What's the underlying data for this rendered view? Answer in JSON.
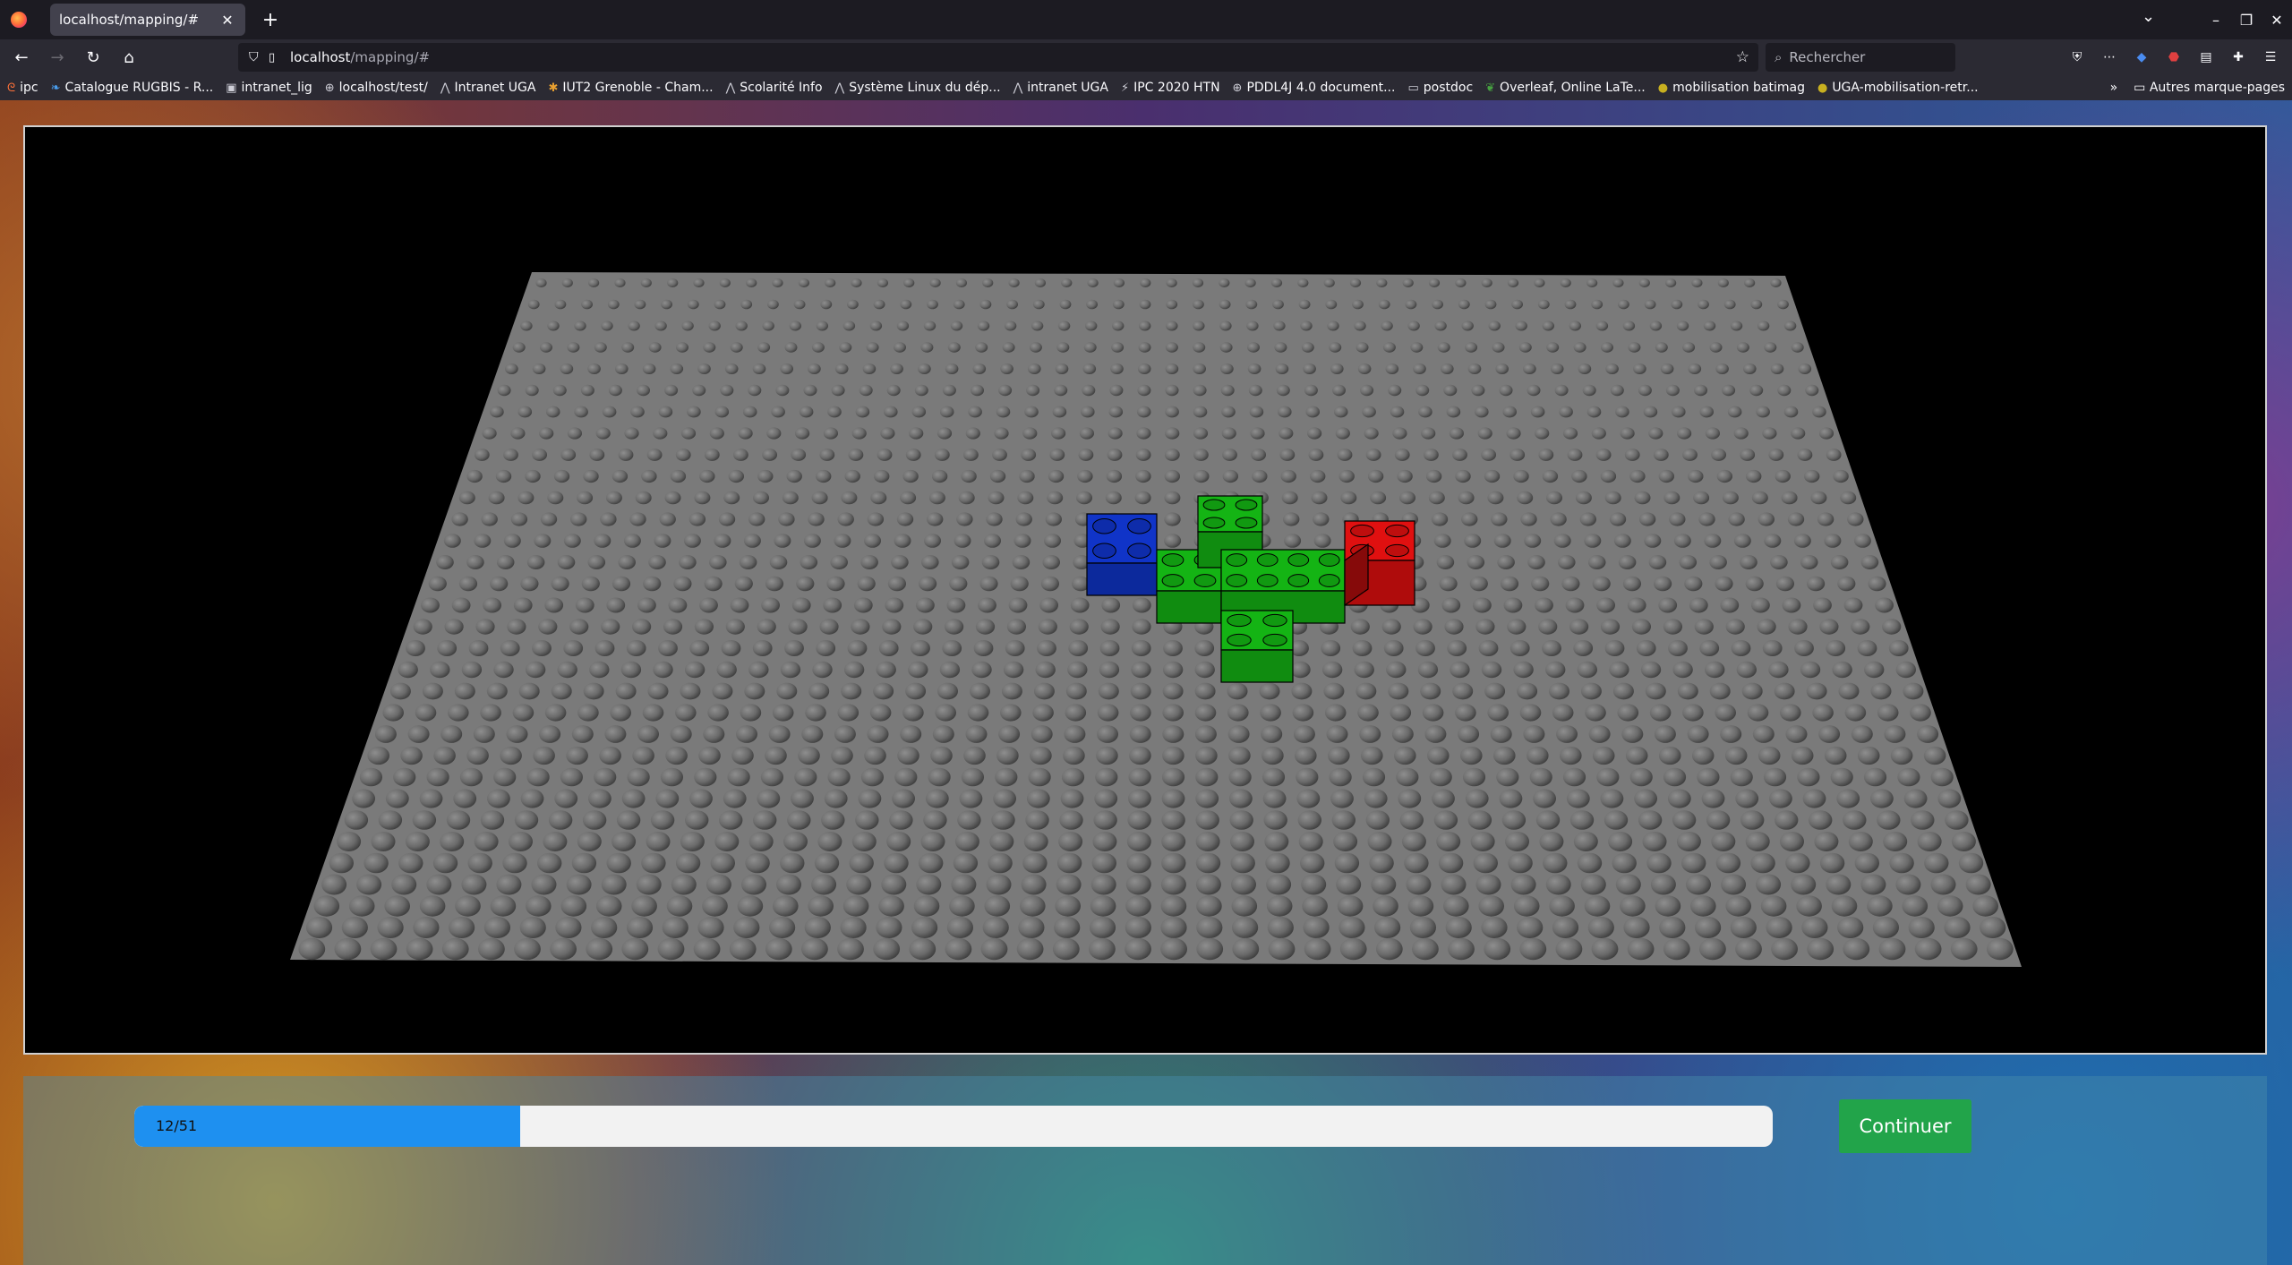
{
  "browser": {
    "tab_title": "localhost/mapping/#",
    "tab_close": "✕",
    "new_tab": "+",
    "url_host": "localhost",
    "url_path": "/mapping/#",
    "search_placeholder": "Rechercher",
    "window_controls": [
      "–",
      "❐",
      "✕"
    ]
  },
  "bookmarks": [
    {
      "label": "ipc",
      "icon": "bookmark-icon"
    },
    {
      "label": "Catalogue RUGBIS - R...",
      "icon": "catalog-icon"
    },
    {
      "label": "intranet_lig",
      "icon": "site-icon"
    },
    {
      "label": "localhost/test/",
      "icon": "globe-icon"
    },
    {
      "label": "Intranet UGA",
      "icon": "uga-icon"
    },
    {
      "label": "IUT2 Grenoble - Cham...",
      "icon": "iut-icon"
    },
    {
      "label": "Scolarité Info",
      "icon": "uga-icon"
    },
    {
      "label": "Système Linux du dép...",
      "icon": "uga-icon"
    },
    {
      "label": "intranet UGA",
      "icon": "uga-icon"
    },
    {
      "label": "IPC 2020 HTN",
      "icon": "ipc-icon"
    },
    {
      "label": "PDDL4J 4.0 document...",
      "icon": "globe-icon"
    },
    {
      "label": "postdoc",
      "icon": "folder-icon"
    },
    {
      "label": "Overleaf, Online LaTe...",
      "icon": "overleaf-icon"
    },
    {
      "label": "mobilisation batimag",
      "icon": "site-icon"
    },
    {
      "label": "UGA-mobilisation-retr...",
      "icon": "site-icon"
    }
  ],
  "other_bookmarks": "Autres marque-pages",
  "scene": {
    "baseplate_color": "#7a7a7a",
    "bricks": [
      {
        "color": "blue",
        "hex": "#1034c8"
      },
      {
        "color": "green",
        "hex": "#14b414"
      },
      {
        "color": "red",
        "hex": "#e01010"
      }
    ]
  },
  "progress": {
    "current": 12,
    "total": 51,
    "label": "12/51",
    "fill_color": "#1e90f0"
  },
  "continue_label": "Continuer",
  "continue_color": "#22a44a"
}
